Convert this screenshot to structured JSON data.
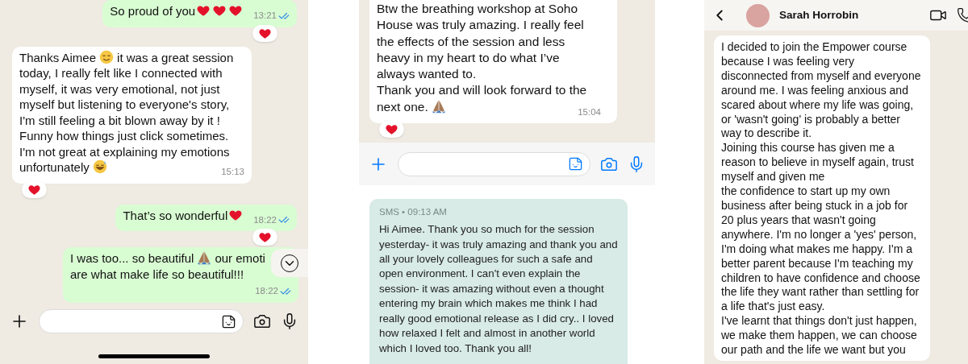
{
  "chat_1": {
    "messages": [
      {
        "outgoing": true,
        "parts": [
          {
            "kind": "text",
            "text": "So proud of you"
          },
          {
            "kind": "heart"
          },
          {
            "kind": "heart"
          },
          {
            "kind": "heart"
          }
        ],
        "time": "13:21",
        "read": true,
        "reaction": true
      },
      {
        "outgoing": false,
        "parts": [
          {
            "kind": "text",
            "text": "Thanks Aimee"
          },
          {
            "kind": "relieved"
          },
          {
            "kind": "text",
            "text": "it was a great session"
          },
          {
            "kind": "text",
            "text": "today, I really felt like I connected with myself, it was very emotional, not just myself but listening to everyone's story, I'm still feeling a bit blown away by it ! Funny how things just click sometimes. I'm not great at explaining my emotions"
          },
          {
            "kind": "text",
            "text": "unfortunately"
          },
          {
            "kind": "sweat"
          }
        ],
        "time": "15:13",
        "reaction": true
      },
      {
        "outgoing": true,
        "parts": [
          {
            "kind": "text",
            "text": "That’s so wonderful"
          },
          {
            "kind": "heart"
          }
        ],
        "time": "18:22",
        "read": true,
        "reaction": true
      },
      {
        "outgoing": true,
        "parts": [
          {
            "kind": "text",
            "text": "I was too... so beautiful"
          },
          {
            "kind": "pray"
          },
          {
            "kind": "text",
            "text": "our emoti"
          },
          {
            "kind": "text",
            "text": "are what make life so beautiful!!!"
          }
        ],
        "time": "18:22",
        "read": true
      }
    ]
  },
  "chat_2": {
    "messages": [
      {
        "outgoing": false,
        "parts": [
          {
            "kind": "text",
            "text": "Btw the breathing workshop at Soho House was truly amazing. I really feel the effects of the session and less heavy in my heart to do what I’ve always wanted to.\nThank you and will look forward to the"
          },
          {
            "kind": "text",
            "text": "next one."
          },
          {
            "kind": "pray"
          }
        ],
        "time": "15:04",
        "reaction": true
      }
    ]
  },
  "sms": {
    "header": "SMS • 09:13 AM",
    "text": "Hi Aimee. Thank you so much for the session yesterday- it was truly amazing and thank you and all your lovely colleagues for such a safe and open environment. I can't even explain the session- it was amazing without even a thought entering my brain which makes me think I had really good emotional release as I did cry.. I loved how relaxed I felt and almost in another world which I loved too. Thank you all!"
  },
  "chat_3": {
    "contact": "Sarah Horrobin",
    "messages": [
      {
        "outgoing": false,
        "parts": [
          {
            "kind": "text",
            "text": "I decided to join the Empower course because I was feeling very disconnected from myself and everyone around me. I was feeling anxious and scared about where my life was going, or 'wasn't going' is probably a better way to describe it.\nJoining this course has given me a reason to believe in myself again, trust myself and given me\nthe confidence to start up my own business after being stuck in a job for 20 plus years that wasn't going anywhere. I'm no longer a 'yes' person, I'm doing what makes me happy. I'm a better parent because I'm teaching my children to have confidence and choose the life they want rather than settling for a life that's just easy.\nI've learnt that things don't just happen, we make them happen, we can choose our path and the life we want but you"
          }
        ]
      }
    ]
  }
}
